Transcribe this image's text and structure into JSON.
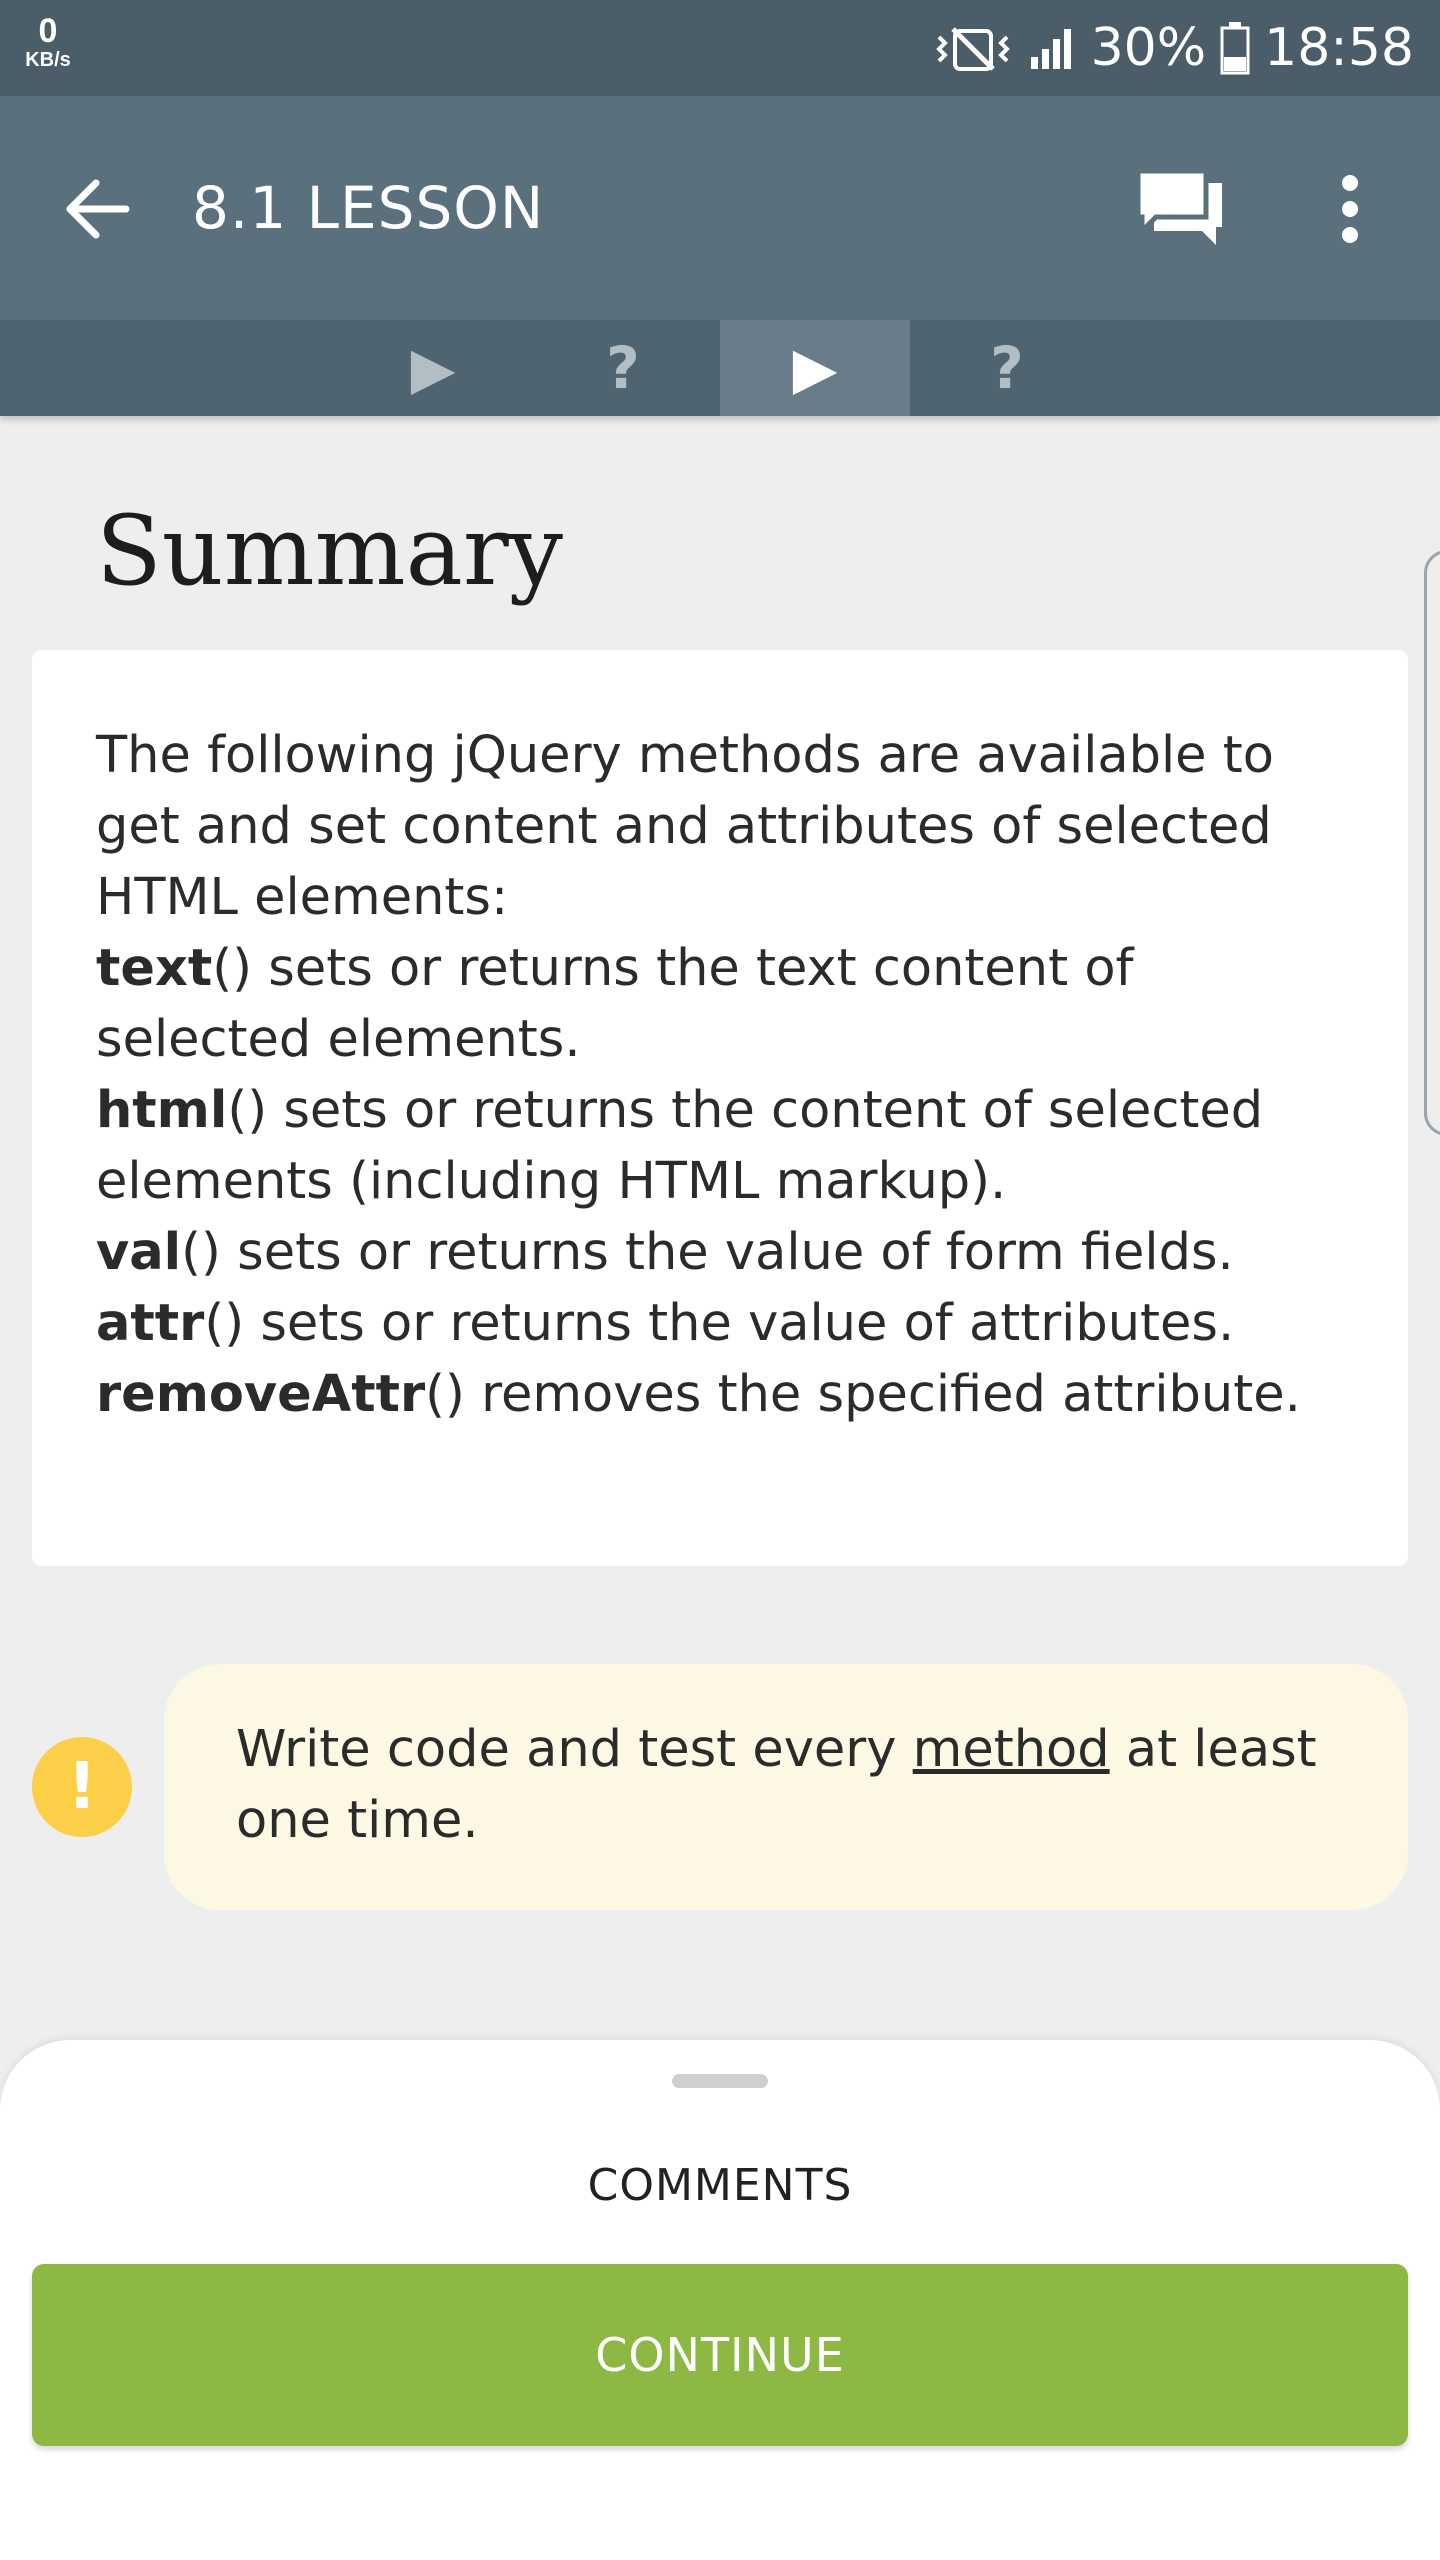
{
  "status_bar": {
    "network_speed_value": "0",
    "network_speed_unit": "KB/s",
    "battery_percent": "30%",
    "time": "18:58",
    "icons": [
      "vibrate-icon",
      "signal-icon",
      "battery-icon"
    ]
  },
  "app_bar": {
    "title": "8.1 LESSON",
    "icons": [
      "back-arrow-icon",
      "chat-icon",
      "more-vertical-icon"
    ]
  },
  "tabs": [
    {
      "label": "▶",
      "active": false
    },
    {
      "label": "?",
      "active": false
    },
    {
      "label": "▶",
      "active": true
    },
    {
      "label": "?",
      "active": false
    }
  ],
  "content": {
    "title": "Summary",
    "intro": "The following jQuery methods are available to get and set content and attributes of selected HTML elements:",
    "methods": [
      {
        "name": "text",
        "desc": "() sets or returns the text content of selected elements."
      },
      {
        "name": "html",
        "desc": "() sets or returns the content of selected elements (including HTML markup)."
      },
      {
        "name": "val",
        "desc": "() sets or returns the value of form fields."
      },
      {
        "name": "attr",
        "desc": "() sets or returns the value of attributes."
      },
      {
        "name": "removeAttr",
        "desc": "() removes the specified attribute."
      }
    ]
  },
  "tip": {
    "icon_symbol": "!",
    "text_before": "Write code and test every ",
    "link_text": "method",
    "text_after": " at least one time."
  },
  "bottom_sheet": {
    "comments_label": "COMMENTS",
    "continue_label": "CONTINUE"
  },
  "colors": {
    "status_bar": "#4a5d69",
    "app_bar": "#5a707c",
    "tab_strip": "#4f6471",
    "tab_active": "#687d89",
    "tip_icon": "#fccf48",
    "tip_background": "#fdf8e3",
    "continue_button": "#8cb843"
  }
}
